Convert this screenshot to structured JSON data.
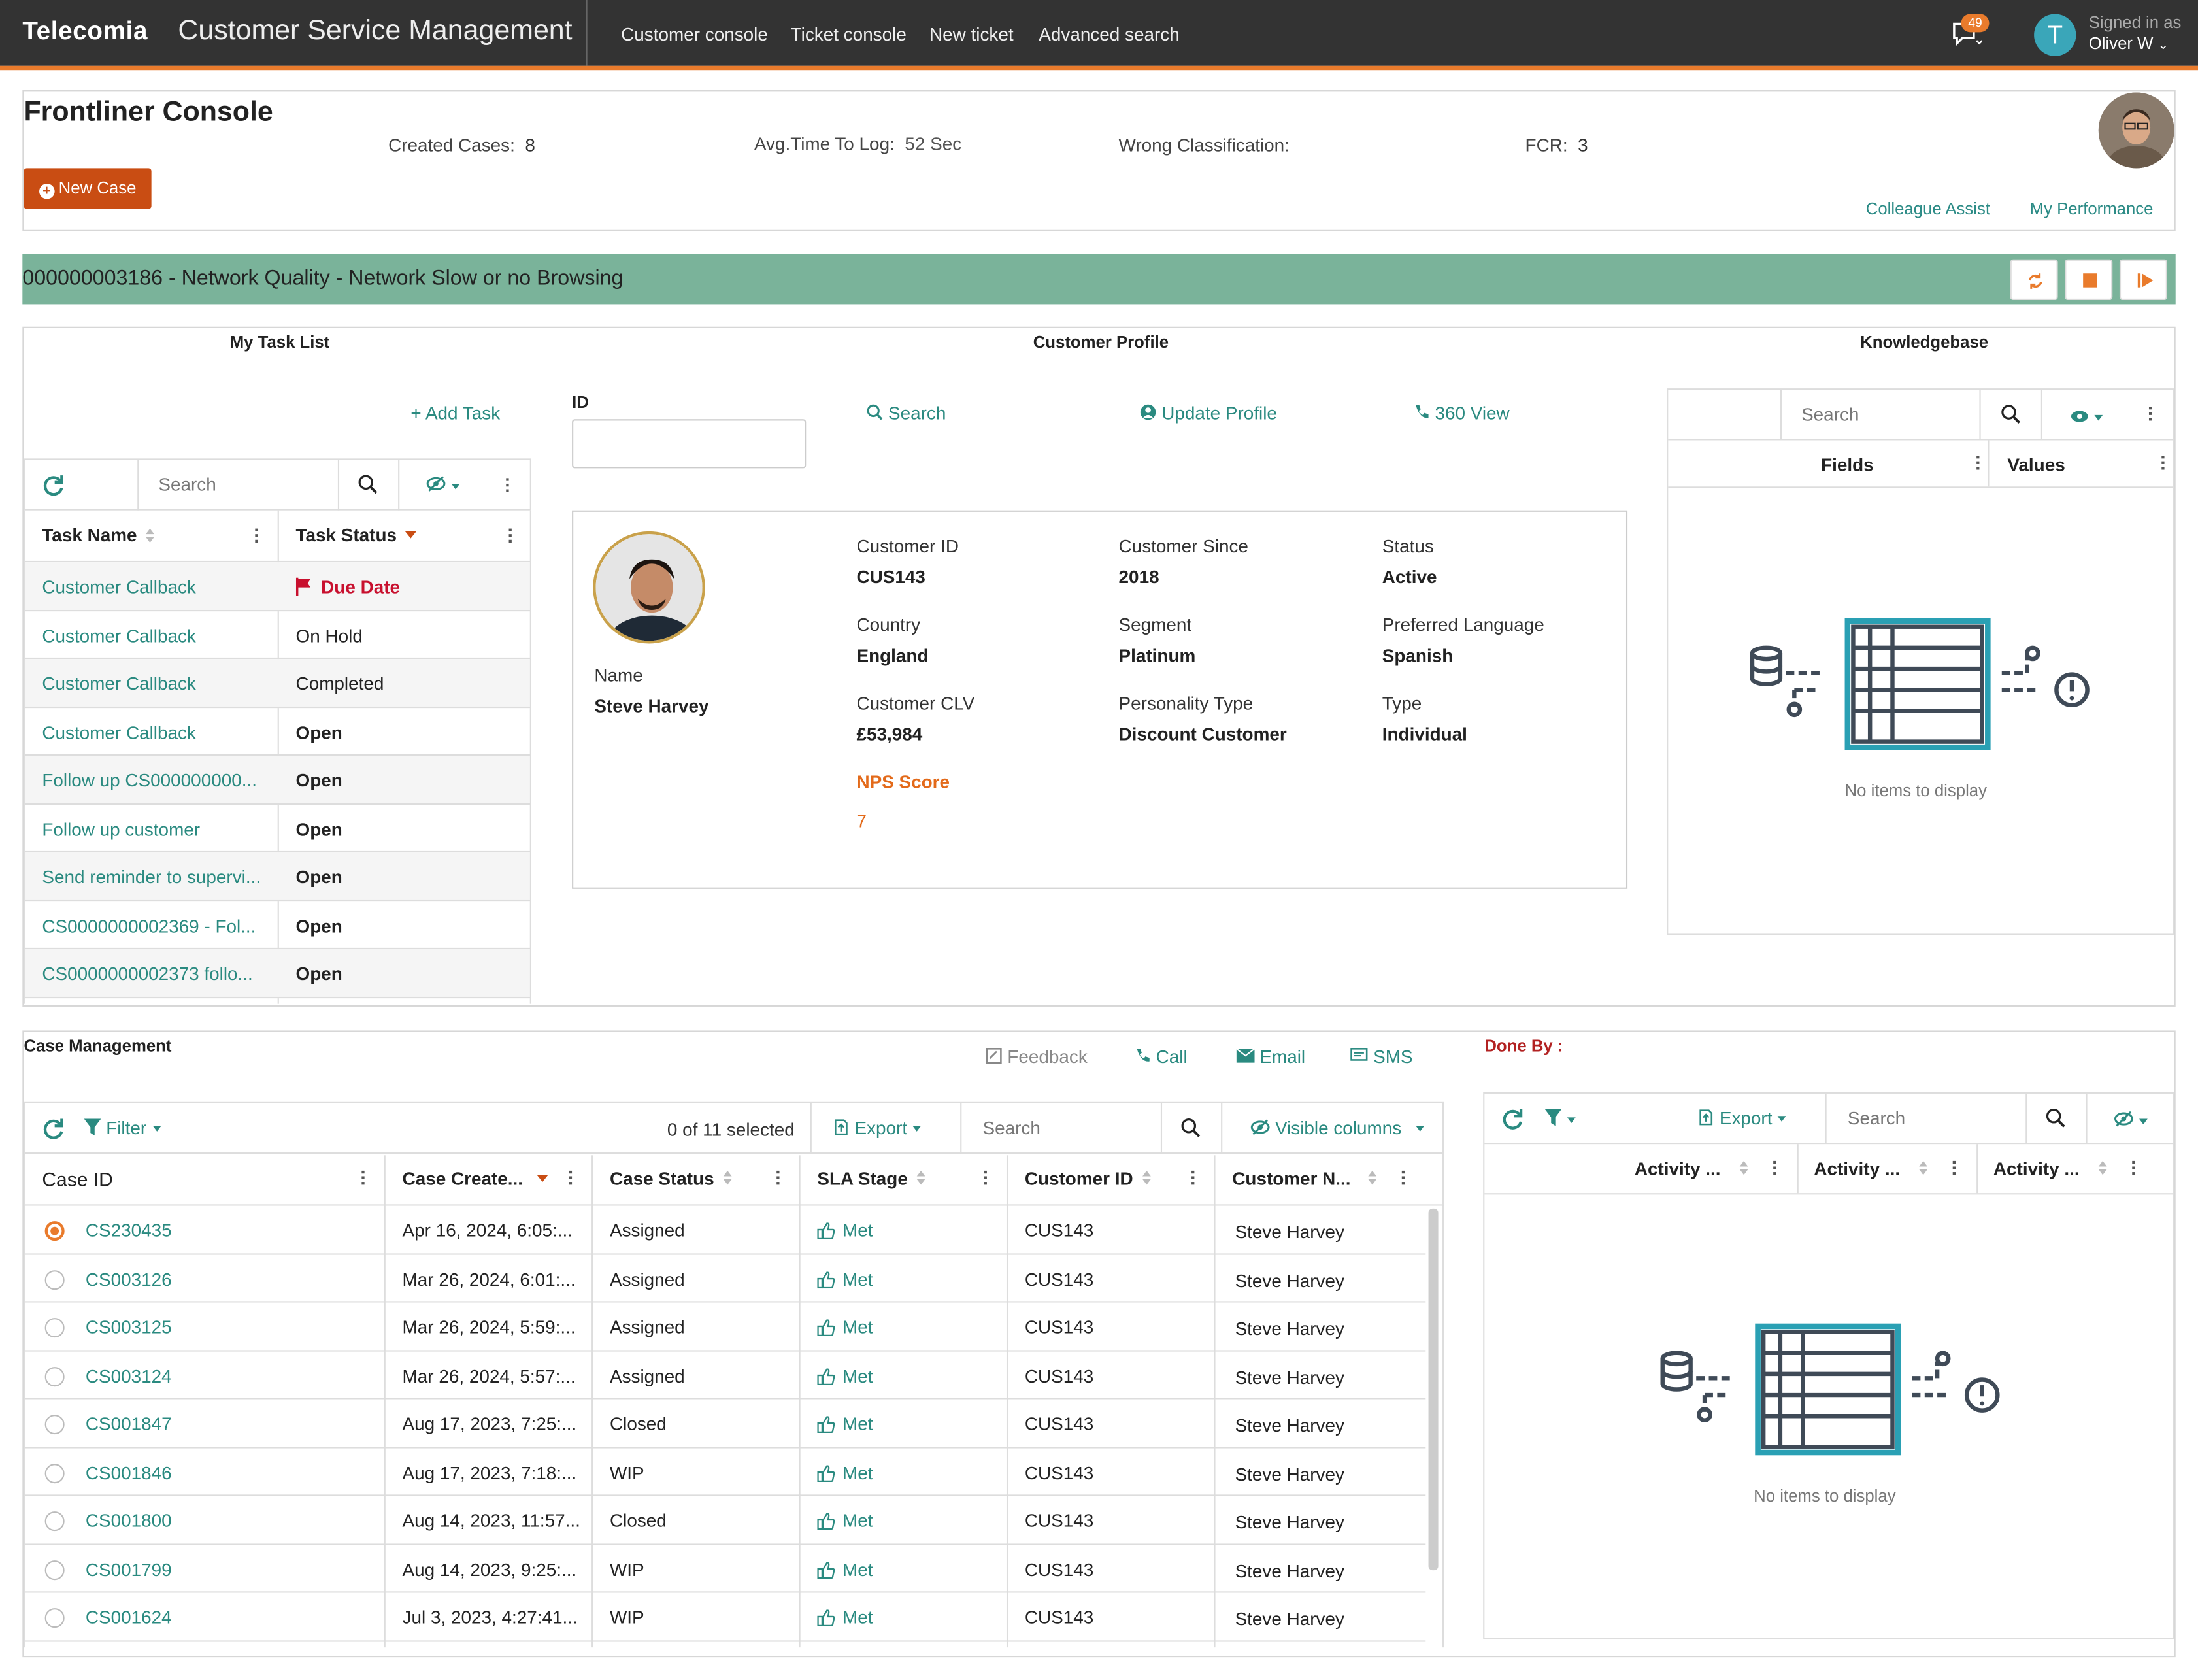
{
  "topbar": {
    "brand": "Telecomia",
    "app_title": "Customer Service Management",
    "nav": [
      "Customer console",
      "Ticket console",
      "New ticket",
      "Advanced search"
    ],
    "notification_count": "49",
    "avatar_initial": "T",
    "signed_in_as": "Signed in as",
    "user_name": "Oliver W"
  },
  "header": {
    "title": "Frontliner Console",
    "new_case_label": "New Case",
    "stats": [
      {
        "label": "Created Cases:",
        "value": "8"
      },
      {
        "label": "Avg.Time To Log:",
        "value": "52 Sec"
      },
      {
        "label": "Wrong Classification:",
        "value": ""
      },
      {
        "label": "FCR:",
        "value": "3"
      }
    ],
    "links": [
      "Colleague Assist",
      "My Performance"
    ]
  },
  "banner": {
    "text": "000000003186 - Network Quality - Network Slow or no Browsing"
  },
  "task_list": {
    "title": "My Task List",
    "add_task": "Add Task",
    "search_placeholder": "Search",
    "columns": [
      "Task Name",
      "Task Status"
    ],
    "rows": [
      {
        "name": "Customer Callback",
        "status": "Due Date"
      },
      {
        "name": "Customer Callback",
        "status": "On Hold"
      },
      {
        "name": "Customer Callback",
        "status": "Completed"
      },
      {
        "name": "Customer Callback",
        "status": "Open"
      },
      {
        "name": "Follow up CS000000000...",
        "status": "Open"
      },
      {
        "name": "Follow up customer",
        "status": "Open"
      },
      {
        "name": "Send reminder to supervi...",
        "status": "Open"
      },
      {
        "name": "CS0000000002369 - Fol...",
        "status": "Open"
      },
      {
        "name": "CS0000000002373 follo...",
        "status": "Open"
      }
    ]
  },
  "customer_profile": {
    "title": "Customer Profile",
    "id_label": "ID",
    "id_value": "",
    "actions": [
      "Search",
      "Update Profile",
      "360 View"
    ],
    "name_label": "Name",
    "name_value": "Steve Harvey",
    "fields": [
      {
        "label": "Customer ID",
        "value": "CUS143"
      },
      {
        "label": "Customer Since",
        "value": "2018"
      },
      {
        "label": "Status",
        "value": "Active"
      },
      {
        "label": "Country",
        "value": "England"
      },
      {
        "label": "Segment",
        "value": "Platinum"
      },
      {
        "label": "Preferred Language",
        "value": "Spanish"
      },
      {
        "label": "Customer CLV",
        "value": "£53,984"
      },
      {
        "label": "Personality Type",
        "value": "Discount Customer"
      },
      {
        "label": "Type",
        "value": "Individual"
      }
    ],
    "nps_label": "NPS  Score",
    "nps_value": "7"
  },
  "knowledgebase": {
    "title": "Knowledgebase",
    "search_placeholder": "Search",
    "columns": [
      "Fields",
      "Values"
    ],
    "empty_text": "No items to display"
  },
  "case_management": {
    "title": "Case Management",
    "actions": [
      "Feedback",
      "Call",
      "Email",
      "SMS"
    ],
    "filter_label": "Filter",
    "selected_text": "0 of 11 selected",
    "export_label": "Export",
    "search_placeholder": "Search",
    "visible_columns_label": "Visible columns",
    "columns": [
      "Case ID",
      "Case Create...",
      "Case Status",
      "SLA Stage",
      "Customer ID",
      "Customer N..."
    ],
    "rows": [
      {
        "id": "CS230435",
        "created": "Apr 16, 2024, 6:05:...",
        "status": "Assigned",
        "sla": "Met",
        "cust_id": "CUS143",
        "cust_name": "Steve Harvey"
      },
      {
        "id": "CS003126",
        "created": "Mar 26, 2024, 6:01:...",
        "status": "Assigned",
        "sla": "Met",
        "cust_id": "CUS143",
        "cust_name": "Steve Harvey"
      },
      {
        "id": "CS003125",
        "created": "Mar 26, 2024, 5:59:...",
        "status": "Assigned",
        "sla": "Met",
        "cust_id": "CUS143",
        "cust_name": "Steve Harvey"
      },
      {
        "id": "CS003124",
        "created": "Mar 26, 2024, 5:57:...",
        "status": "Assigned",
        "sla": "Met",
        "cust_id": "CUS143",
        "cust_name": "Steve Harvey"
      },
      {
        "id": "CS001847",
        "created": "Aug 17, 2023, 7:25:...",
        "status": "Closed",
        "sla": "Met",
        "cust_id": "CUS143",
        "cust_name": "Steve Harvey"
      },
      {
        "id": "CS001846",
        "created": "Aug 17, 2023, 7:18:...",
        "status": "WIP",
        "sla": "Met",
        "cust_id": "CUS143",
        "cust_name": "Steve Harvey"
      },
      {
        "id": "CS001800",
        "created": "Aug 14, 2023, 11:57...",
        "status": "Closed",
        "sla": "Met",
        "cust_id": "CUS143",
        "cust_name": "Steve Harvey"
      },
      {
        "id": "CS001799",
        "created": "Aug 14, 2023, 9:25:...",
        "status": "WIP",
        "sla": "Met",
        "cust_id": "CUS143",
        "cust_name": "Steve Harvey"
      },
      {
        "id": "CS001624",
        "created": "Jul 3, 2023, 4:27:41...",
        "status": "WIP",
        "sla": "Met",
        "cust_id": "CUS143",
        "cust_name": "Steve Harvey"
      }
    ]
  },
  "done_by": {
    "title": "Done By :",
    "export_label": "Export",
    "search_placeholder": "Search",
    "columns": [
      "Activity ...",
      "Activity ...",
      "Activity ..."
    ],
    "empty_text": "No items to display"
  },
  "colors": {
    "accent": "#e97b2c",
    "brand_dark": "#333333",
    "teal": "#0d8272",
    "banner": "#7ab39a",
    "due_date": "#c8102e"
  }
}
